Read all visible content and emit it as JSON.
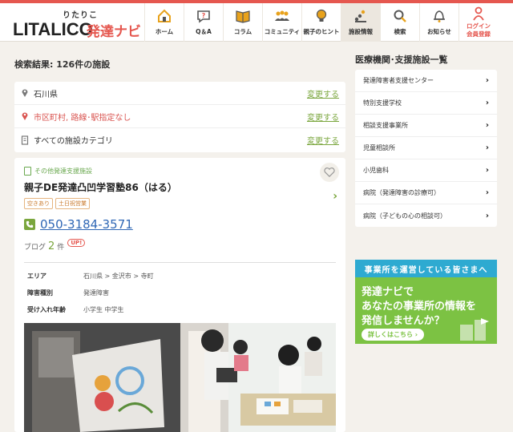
{
  "header": {
    "logo_sub": "りたりこ",
    "logo_main": "LITALICO",
    "logo_product": "発達ナビ",
    "nav": [
      {
        "label": "ホーム",
        "icon": "home-icon"
      },
      {
        "label": "Q＆A",
        "icon": "question-bubble-icon"
      },
      {
        "label": "コラム",
        "icon": "book-icon"
      },
      {
        "label": "コミュニティ",
        "icon": "people-icon"
      },
      {
        "label": "親子のヒント",
        "icon": "lightbulb-icon"
      },
      {
        "label": "施設情報",
        "icon": "facility-icon"
      },
      {
        "label": "検索",
        "icon": "search-icon"
      },
      {
        "label": "お知らせ",
        "icon": "bell-icon"
      }
    ],
    "login_line1": "ログイン",
    "login_line2": "会員登録"
  },
  "main": {
    "result_title": "検索結果: 126件の施設",
    "filters": [
      {
        "text": "石川県",
        "change": "変更する"
      },
      {
        "text": "市区町村, 路線･駅指定なし",
        "change": "変更する"
      },
      {
        "text": "すべての施設カテゴリ",
        "change": "変更する"
      }
    ],
    "card": {
      "category": "その他発達支援施設",
      "name": "親子DE発達凸凹学習塾86（はる）",
      "tags": [
        "空きあり",
        "土日祝営業"
      ],
      "phone": "050-3184-3571",
      "blog_label": "ブログ",
      "blog_count": "2",
      "blog_unit": "件",
      "blog_badge": "UP!",
      "info": [
        {
          "label": "エリア",
          "value": "石川県 > 金沢市 > 寺町"
        },
        {
          "label": "障害種別",
          "value": "発達障害"
        },
        {
          "label": "受け入れ年齢",
          "value": "小学生 中学生"
        }
      ]
    }
  },
  "sidebar": {
    "title": "医療機関･支援施設一覧",
    "items": [
      "発達障害者支援センター",
      "特別支援学校",
      "相談支援事業所",
      "児童相談所",
      "小児歯科",
      "病院（発達障害の診療可）",
      "病院（子どもの心の相談可）"
    ],
    "banner": {
      "head": "事業所を運営している皆さまへ",
      "line1": "発達ナビで",
      "line2": "あなたの事業所の情報を",
      "line3": "発信しませんか？",
      "button": "詳しくはこちら ›"
    }
  },
  "colors": {
    "brand_red": "#e5574f",
    "accent_green": "#7aa63d",
    "link_blue": "#2f67b5",
    "banner_blue": "#2eaad1",
    "banner_green": "#7cc243"
  }
}
